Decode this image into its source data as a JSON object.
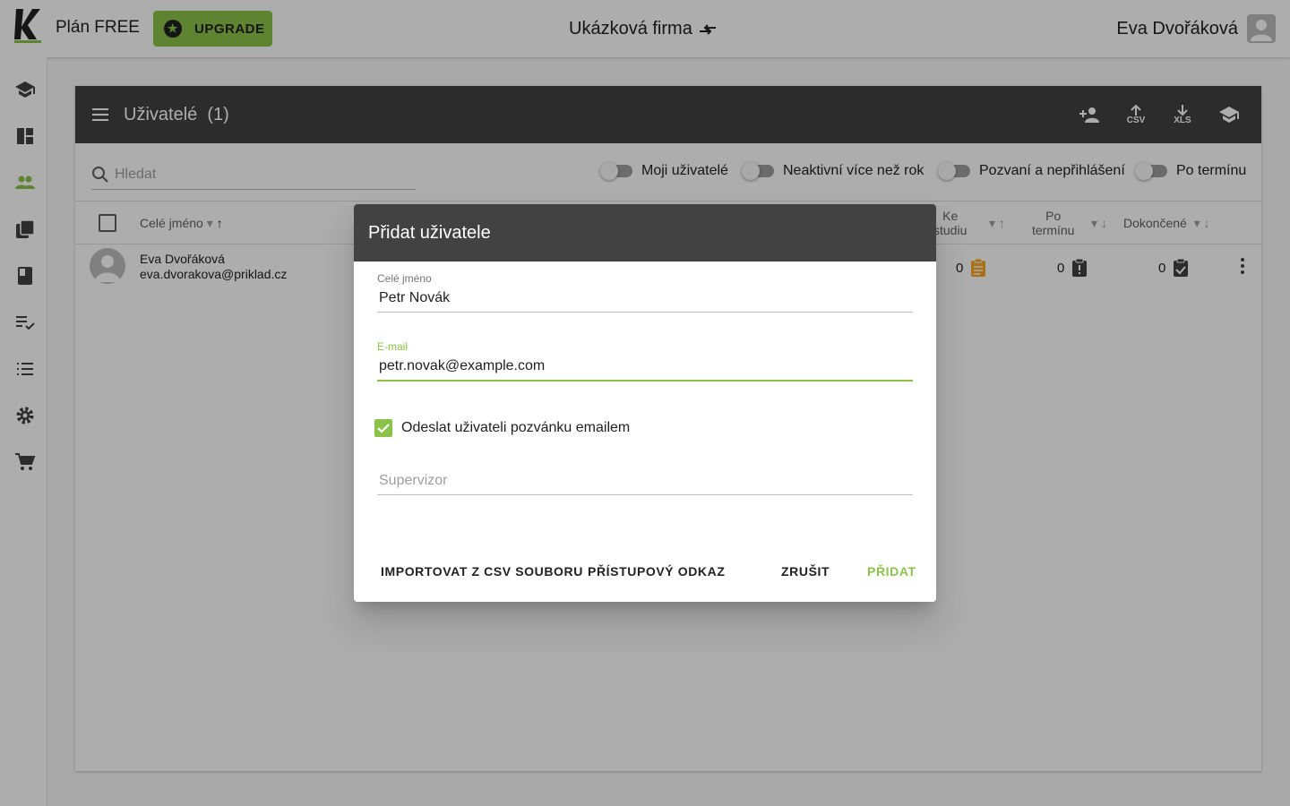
{
  "topbar": {
    "plan_label": "Plán FREE",
    "upgrade_label": "UPGRADE",
    "company_name": "Ukázková firma",
    "user_name": "Eva Dvořáková"
  },
  "sidebar": {
    "items": [
      "school-icon",
      "dashboard-icon",
      "people-icon",
      "library-icon",
      "book-icon",
      "playlist-check-icon",
      "list-icon",
      "gear-icon",
      "cart-icon"
    ]
  },
  "users_panel": {
    "title": "Uživatelé",
    "count": "(1)",
    "search_placeholder": "Hledat",
    "icons": {
      "csv": "CSV",
      "xls": "XLS"
    },
    "toggles": [
      "Moji uživatelé",
      "Neaktivní více než rok",
      "Pozvaní a nepřihlášení",
      "Po termínu"
    ],
    "columns": {
      "name": "Celé jméno",
      "to_study_1": "Ke",
      "to_study_2": "studiu",
      "overdue_1": "Po",
      "overdue_2": "termínu",
      "completed": "Dokončené"
    },
    "rows": [
      {
        "name": "Eva Dvořáková",
        "email": "eva.dvorakova@priklad.cz",
        "to_study": "0",
        "overdue": "0",
        "completed": "0"
      }
    ]
  },
  "dialog": {
    "title": "Přidat uživatele",
    "name_label": "Celé jméno",
    "name_value": "Petr Novák",
    "email_label": "E-mail",
    "email_value": "petr.novak@example.com",
    "invite_label": "Odeslat uživateli pozvánku emailem",
    "supervisor_placeholder": "Supervizor",
    "buttons": {
      "import_csv": "IMPORTOVAT Z CSV SOUBORU",
      "access_link": "PŘÍSTUPOVÝ ODKAZ",
      "cancel": "ZRUŠIT",
      "add": "PŘIDAT"
    }
  },
  "colors": {
    "accent": "#8bc34a",
    "header": "#424242",
    "badge_orange": "#f9a825"
  }
}
